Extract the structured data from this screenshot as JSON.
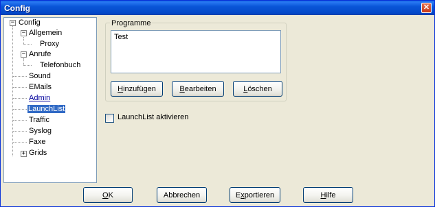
{
  "window": {
    "title": "Config",
    "close_glyph": "✕"
  },
  "tree": {
    "expander_collapse": "−",
    "expander_expand": "+",
    "items": [
      {
        "label": "Config",
        "expanded": true
      },
      {
        "label": "Allgemein",
        "expanded": true
      },
      {
        "label": "Proxy"
      },
      {
        "label": "Anrufe",
        "expanded": true
      },
      {
        "label": "Telefonbuch"
      },
      {
        "label": "Sound"
      },
      {
        "label": "EMails"
      },
      {
        "label": "Admin"
      },
      {
        "label": "LaunchList",
        "selected": true
      },
      {
        "label": "Traffic"
      },
      {
        "label": "Syslog"
      },
      {
        "label": "Faxe"
      },
      {
        "label": "Grids",
        "expanded": false
      }
    ]
  },
  "programme": {
    "group_label": "Programme",
    "items": [
      "Test"
    ],
    "add_first": "H",
    "add_rest": "inzufügen",
    "edit_first": "B",
    "edit_rest": "earbeiten",
    "delete_first": "L",
    "delete_rest": "öschen"
  },
  "launchlist_checkbox": {
    "label": "LaunchList aktivieren",
    "checked": false
  },
  "footer": {
    "ok_first": "O",
    "ok_rest": "K",
    "cancel_label": "Abbrechen",
    "export_pre": "E",
    "export_u": "x",
    "export_post": "portieren",
    "help_first": "H",
    "help_rest": "ilfe"
  },
  "colors": {
    "selection": "#316ac5",
    "titlebar": "#0a56d8",
    "face": "#ece9d8"
  }
}
